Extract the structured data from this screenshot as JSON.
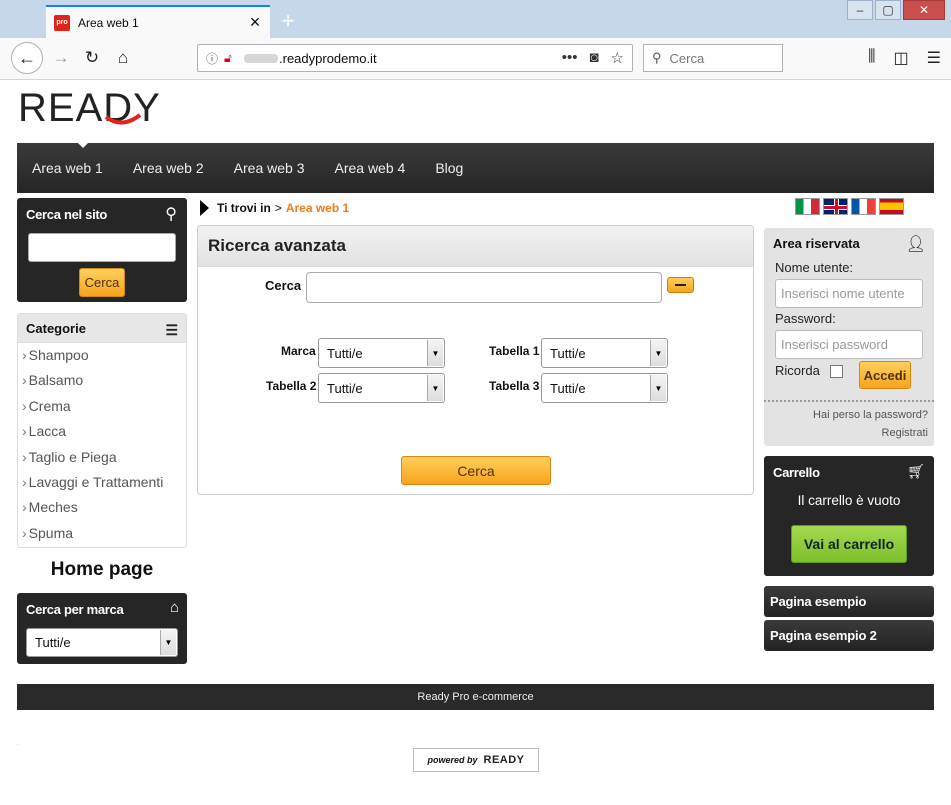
{
  "browser": {
    "tab_title": "Area web 1",
    "tab_favicon_text": "pro",
    "url": ".readyprodemo.it",
    "search_placeholder": "Cerca"
  },
  "site": {
    "logo_text": "READY",
    "nav": [
      "Area web 1",
      "Area web 2",
      "Area web 3",
      "Area web 4",
      "Blog"
    ]
  },
  "search_site": {
    "title": "Cerca nel sito",
    "button": "Cerca"
  },
  "categories": {
    "title": "Categorie",
    "items": [
      "Shampoo",
      "Balsamo",
      "Crema",
      "Lacca",
      "Taglio e Piega",
      "Lavaggi e Trattamenti",
      "Meches",
      "Spuma"
    ]
  },
  "home_page": "Home page",
  "brand_search": {
    "title": "Cerca per marca",
    "selected": "Tutti/e"
  },
  "breadcrumb": {
    "prefix": "Ti trovi in",
    "separator": ">",
    "current": "Area web 1"
  },
  "advanced_search": {
    "title": "Ricerca avanzata",
    "cerca_label": "Cerca",
    "marca_label": "Marca",
    "marca_value": "Tutti/e",
    "tabella1_label": "Tabella 1",
    "tabella1_value": "Tutti/e",
    "tabella2_label": "Tabella 2",
    "tabella2_value": "Tutti/e",
    "tabella3_label": "Tabella 3",
    "tabella3_value": "Tutti/e",
    "button": "Cerca"
  },
  "reserved": {
    "title": "Area riservata",
    "username_label": "Nome utente:",
    "username_placeholder": "Inserisci nome utente",
    "password_label": "Password:",
    "password_placeholder": "Inserisci password",
    "remember_label": "Ricorda",
    "login_button": "Accedi",
    "forgot_link": "Hai perso la password?",
    "register_link": "Registrati"
  },
  "cart": {
    "title": "Carrello",
    "empty_text": "Il carrello è vuoto",
    "button": "Vai al carrello"
  },
  "pages": [
    "Pagina esempio",
    "Pagina esempio 2"
  ],
  "footer": {
    "text": "Ready Pro e-commerce",
    "powered_by": "powered by",
    "powered_brand": "READY"
  },
  "colors": {
    "accent_orange": "#f7a41d",
    "breadcrumb_current": "#f37b1d",
    "dark_box": "#262626",
    "cart_button": "#7cbf2a"
  }
}
